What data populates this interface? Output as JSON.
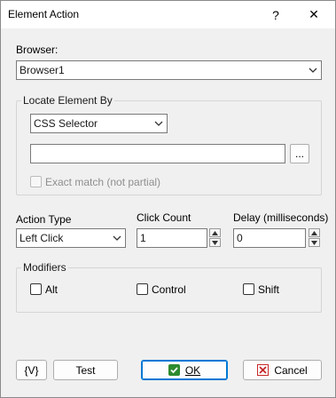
{
  "window": {
    "title": "Element Action",
    "help_glyph": "?",
    "close_glyph": "✕"
  },
  "browser": {
    "label": "Browser:",
    "value": "Browser1"
  },
  "locate": {
    "group_label": "Locate Element By",
    "method_value": "CSS Selector",
    "selector_value": "",
    "browse_label": "...",
    "exact_match_label": "Exact match (not partial)",
    "exact_match_checked": false
  },
  "action": {
    "type_label": "Action Type",
    "type_value": "Left Click",
    "click_count_label": "Click Count",
    "click_count_value": "1",
    "delay_label": "Delay (milliseconds)",
    "delay_value": "0"
  },
  "modifiers": {
    "group_label": "Modifiers",
    "alt_label": "Alt",
    "control_label": "Control",
    "shift_label": "Shift"
  },
  "footer": {
    "variables_label": "{V}",
    "test_label": "Test",
    "ok_label": "OK",
    "cancel_label": "Cancel"
  },
  "colors": {
    "accent": "#0078d4",
    "ok_icon": "#2e8b2e",
    "cancel_icon": "#c62828"
  }
}
